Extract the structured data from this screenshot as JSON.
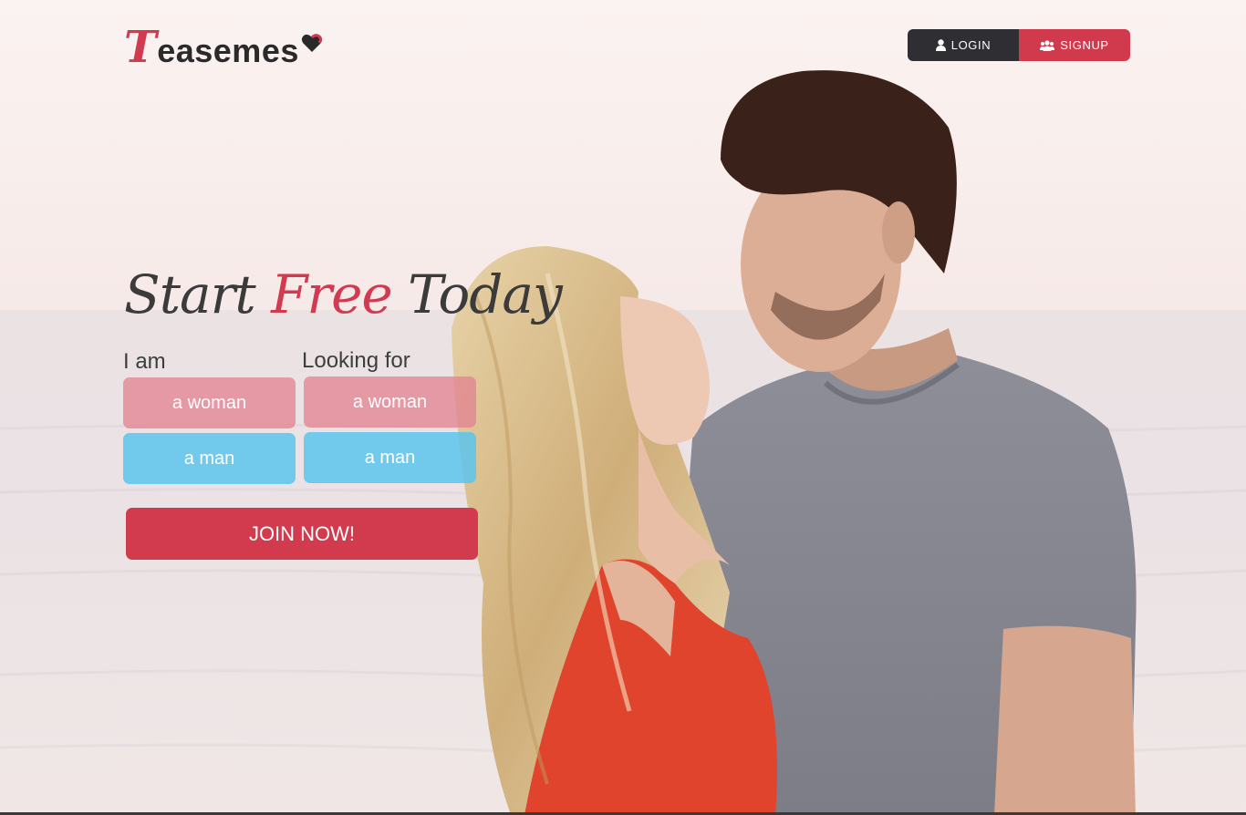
{
  "header": {
    "logo_text": "Teasemes",
    "login_label": "LOGIN",
    "signup_label": "SIGNUP",
    "login_icon": "user-icon",
    "signup_icon": "group-icon"
  },
  "hero": {
    "headline_part1": "Start",
    "headline_accent": "Free",
    "headline_part2": "Today"
  },
  "form": {
    "i_am_label": "I am",
    "looking_for_label": "Looking for",
    "i_am_options": [
      "a woman",
      "a man"
    ],
    "looking_for_options": [
      "a woman",
      "a man"
    ],
    "join_label": "JOIN NOW!"
  },
  "colors": {
    "brand_red": "#d23b4f",
    "dark": "#2f2f33",
    "woman_option": "#e28492",
    "man_option": "#5cc4ec"
  }
}
